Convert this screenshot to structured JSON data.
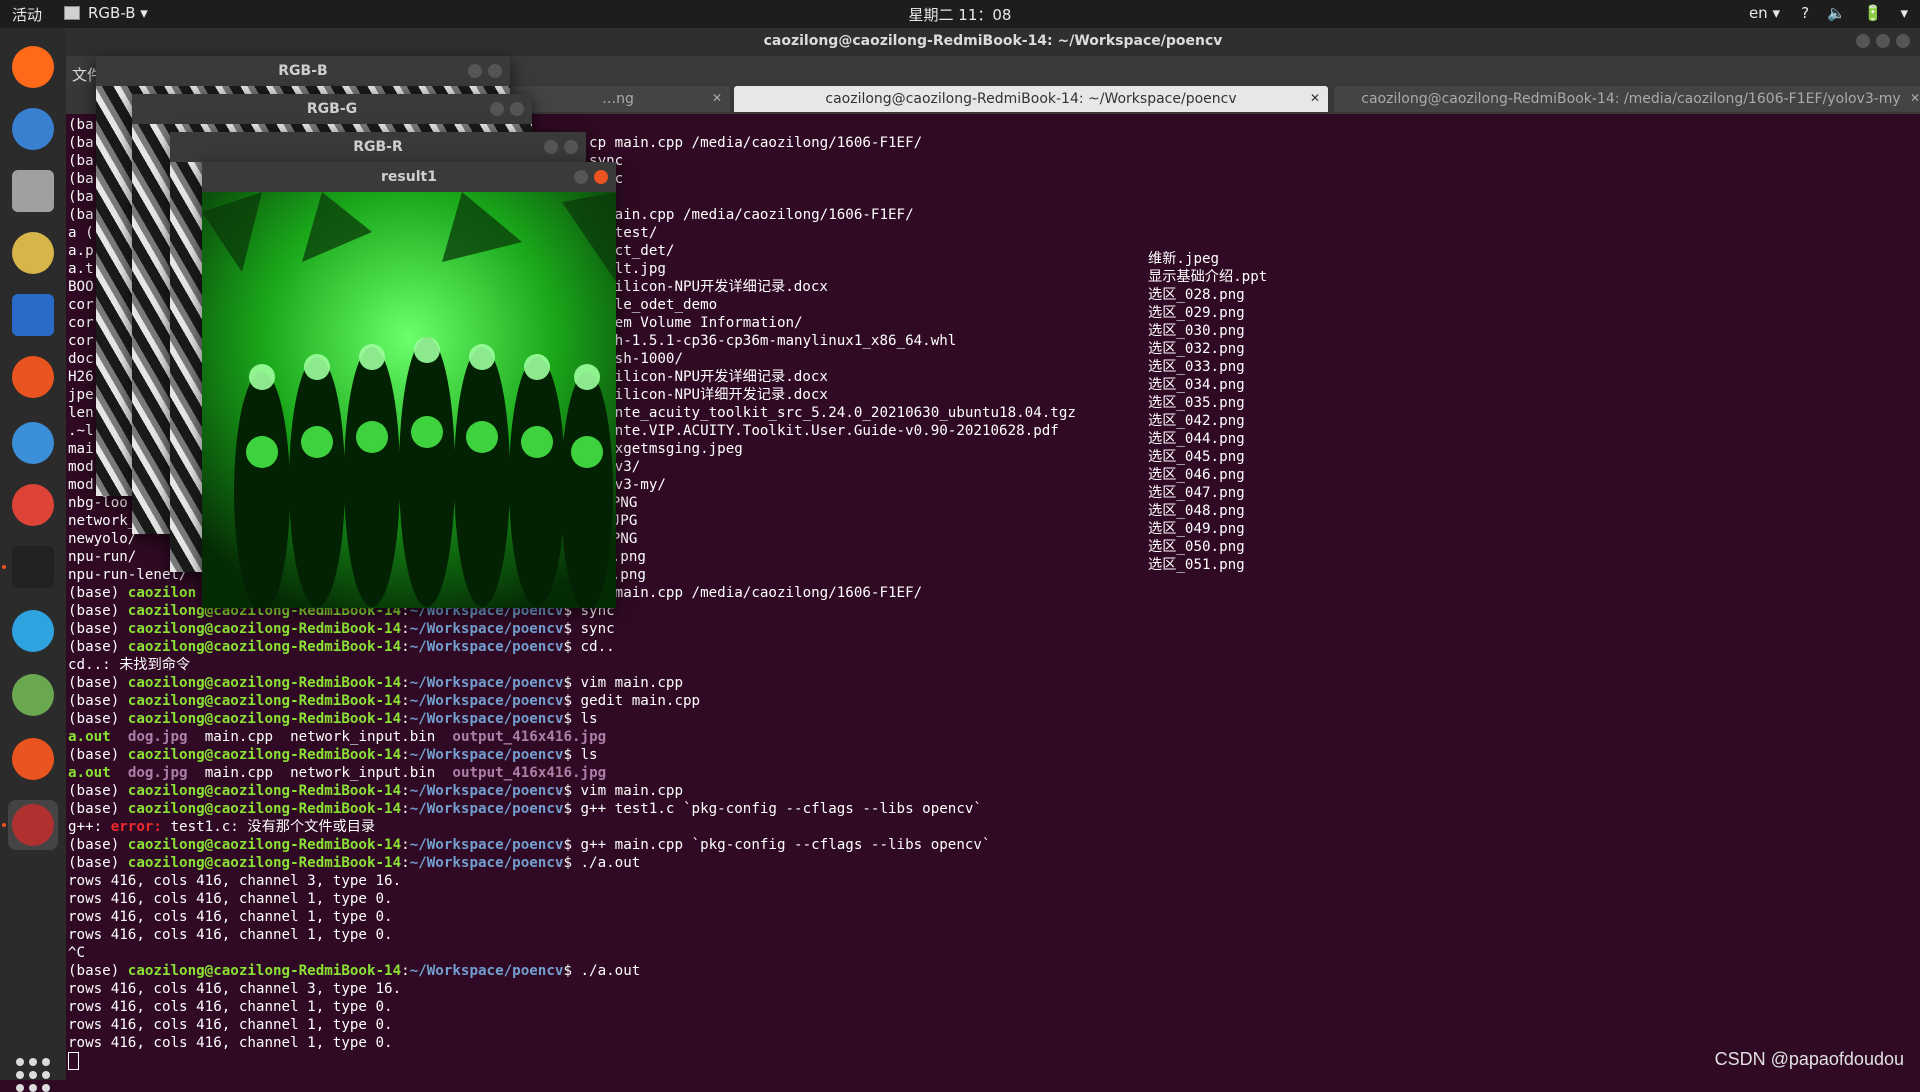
{
  "topbar": {
    "activities": "活动",
    "app_menu": "RGB-B ▾",
    "clock": "星期二 11：08",
    "lang": "en ▾",
    "tray": [
      "?",
      "🔈",
      "🔋",
      "▾"
    ]
  },
  "dock": {
    "items": [
      {
        "name": "firefox-icon",
        "color": "#ff6a1a"
      },
      {
        "name": "thunderbird-icon",
        "color": "#3a80d0"
      },
      {
        "name": "files-icon",
        "color": "#a0a0a0"
      },
      {
        "name": "rhythmbox-icon",
        "color": "#d6b64a"
      },
      {
        "name": "writer-icon",
        "color": "#2a6ac8"
      },
      {
        "name": "software-center-icon",
        "color": "#e95420"
      },
      {
        "name": "help-icon",
        "color": "#3b8ed8"
      },
      {
        "name": "chrome-icon",
        "color": "#dd4437"
      },
      {
        "name": "terminal-icon",
        "color": "#222222"
      },
      {
        "name": "settings-icon",
        "color": "#2ea3e0"
      },
      {
        "name": "image-viewer-icon",
        "color": "#6aa84f"
      },
      {
        "name": "network-app-icon",
        "color": "#e95420"
      },
      {
        "name": "blocked-app-icon",
        "color": "#b03030"
      }
    ]
  },
  "window": {
    "title": "caozilong@caozilong-RedmiBook-14: ~/Workspace/poencv",
    "menu_file": "文件",
    "tabs": [
      {
        "label": "…ng"
      },
      {
        "label": "caozilong@caozilong-RedmiBook-14: ~/Workspace/poencv"
      },
      {
        "label": "caozilong@caozilong-RedmiBook-14: /media/caozilong/1606-F1EF/yolov3-my"
      }
    ]
  },
  "terminal": {
    "user": "caozilong@caozilong-RedmiBook-14",
    "path": "~/Workspace/poencv",
    "col2": [
      "维新.jpeg",
      "显示基础介绍.ppt",
      "选区_028.png",
      "选区_029.png",
      "选区_030.png",
      "选区_032.png",
      "选区_033.png",
      "选区_034.png",
      "选区_035.png",
      "选区_042.png",
      "选区_044.png",
      "选区_045.png",
      "选区_046.png",
      "选区_047.png",
      "选区_048.png",
      "选区_049.png",
      "选区_050.png",
      "选区_051.png"
    ]
  },
  "image_windows": {
    "b": "RGB-B",
    "g": "RGB-G",
    "r": "RGB-R",
    "result": "result1"
  },
  "watermark": "CSDN @papaofdoudou"
}
